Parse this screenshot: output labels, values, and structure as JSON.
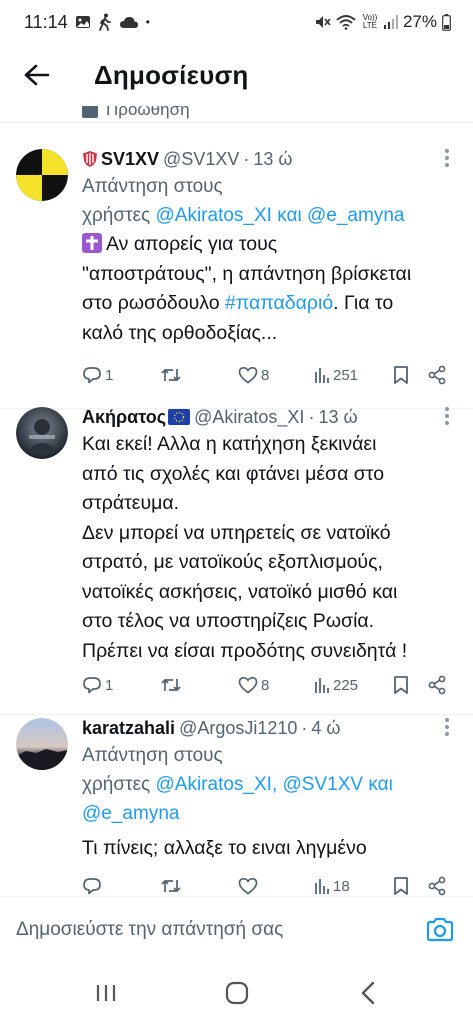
{
  "status_bar": {
    "time": "11:14",
    "dot": "•",
    "battery": "27%",
    "network_label": "Vo)) LTE",
    "icons": [
      "image-icon",
      "walking-icon",
      "cloud-icon",
      "mute-icon",
      "wifi-icon",
      "signal-icon",
      "battery-icon"
    ]
  },
  "header": {
    "title": "Δημοσίευση"
  },
  "promo": {
    "label": "Προώθηση"
  },
  "tweets": [
    {
      "name": "SV1XV",
      "handle": "@SV1XV",
      "time": "13 ώ",
      "replying_prefix": "Απάντηση στους",
      "replying_line2_prefix": "χρήστες",
      "replying_to": [
        "@Akiratos_XI",
        "@e_amyna"
      ],
      "replying_joiner": "και",
      "text_lines": [
        "Αν απορείς για τους",
        "\"αποστράτους\", η απάντηση βρίσκεται",
        "στο ρωσόδουλο",
        ". Για το",
        "καλό της ορθοδοξίας..."
      ],
      "hashtag": "#παπαδαριό",
      "emoji": "✝",
      "replies": "1",
      "retweets": "",
      "likes": "8",
      "views": "251"
    },
    {
      "name": "Ακήρατος",
      "handle": "@Akiratos_XI",
      "time": "13 ώ",
      "text_lines": [
        "Και εκεί! Αλλα η κατήχηση ξεκινάει",
        "από τις σχολές και φτάνει μέσα στο",
        "στράτευμα.",
        "Δεν μπορεί να υπηρετείς σε νατοϊκό",
        "στρατό, με νατοϊκούς εξοπλισμούς,",
        "νατοϊκές ασκήσεις, νατοϊκό μισθό και",
        "στο τέλος να υποστηρίζεις Ρωσία.",
        "Πρέπει να είσαι προδότης συνειδητά !"
      ],
      "replies": "1",
      "retweets": "",
      "likes": "8",
      "views": "225"
    },
    {
      "name": "karatzahali",
      "handle": "@ArgosJi1210",
      "time": "4 ώ",
      "replying_prefix": "Απάντηση στους",
      "replying_line2_prefix": "χρήστες",
      "replying_to": [
        "@Akiratos_XI,",
        "@SV1XV",
        "@e_amyna"
      ],
      "replying_joiner": "και",
      "text_lines": [
        "Τι πίνεις; αλλαξε το ειναι ληγμένο"
      ],
      "replies": "",
      "retweets": "",
      "likes": "",
      "views": "18"
    }
  ],
  "reply_box": {
    "placeholder": "Δημοσιεύστε την απάντησή σας"
  },
  "colors": {
    "accent": "#1d9bf0",
    "secondary_text": "#536471",
    "primary_text": "#0f1419"
  }
}
